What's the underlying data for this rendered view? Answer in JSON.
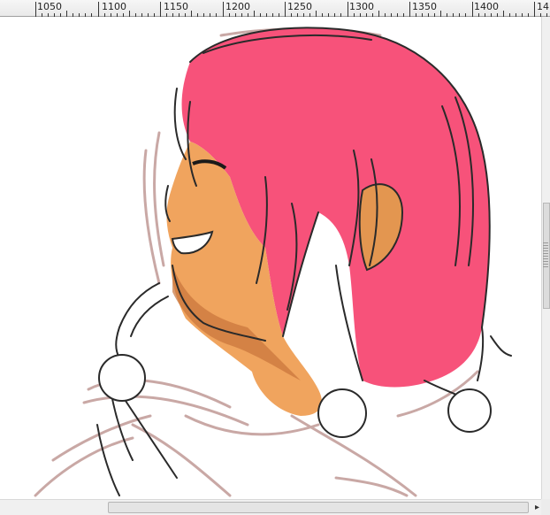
{
  "ruler": {
    "labels": [
      "1050",
      "1100",
      "1150",
      "1200",
      "1250",
      "1300",
      "1350",
      "1400",
      "14"
    ]
  },
  "colors": {
    "hair": "#f7527a",
    "skin": "#f0a45e",
    "skin_shadow": "#c8743a",
    "sketch": "#2a2a2a",
    "rough_sketch": "#c09a96"
  },
  "icons": {
    "scroll_right": "triangle-right-icon",
    "scroll_grip": "grip-lines-icon"
  }
}
